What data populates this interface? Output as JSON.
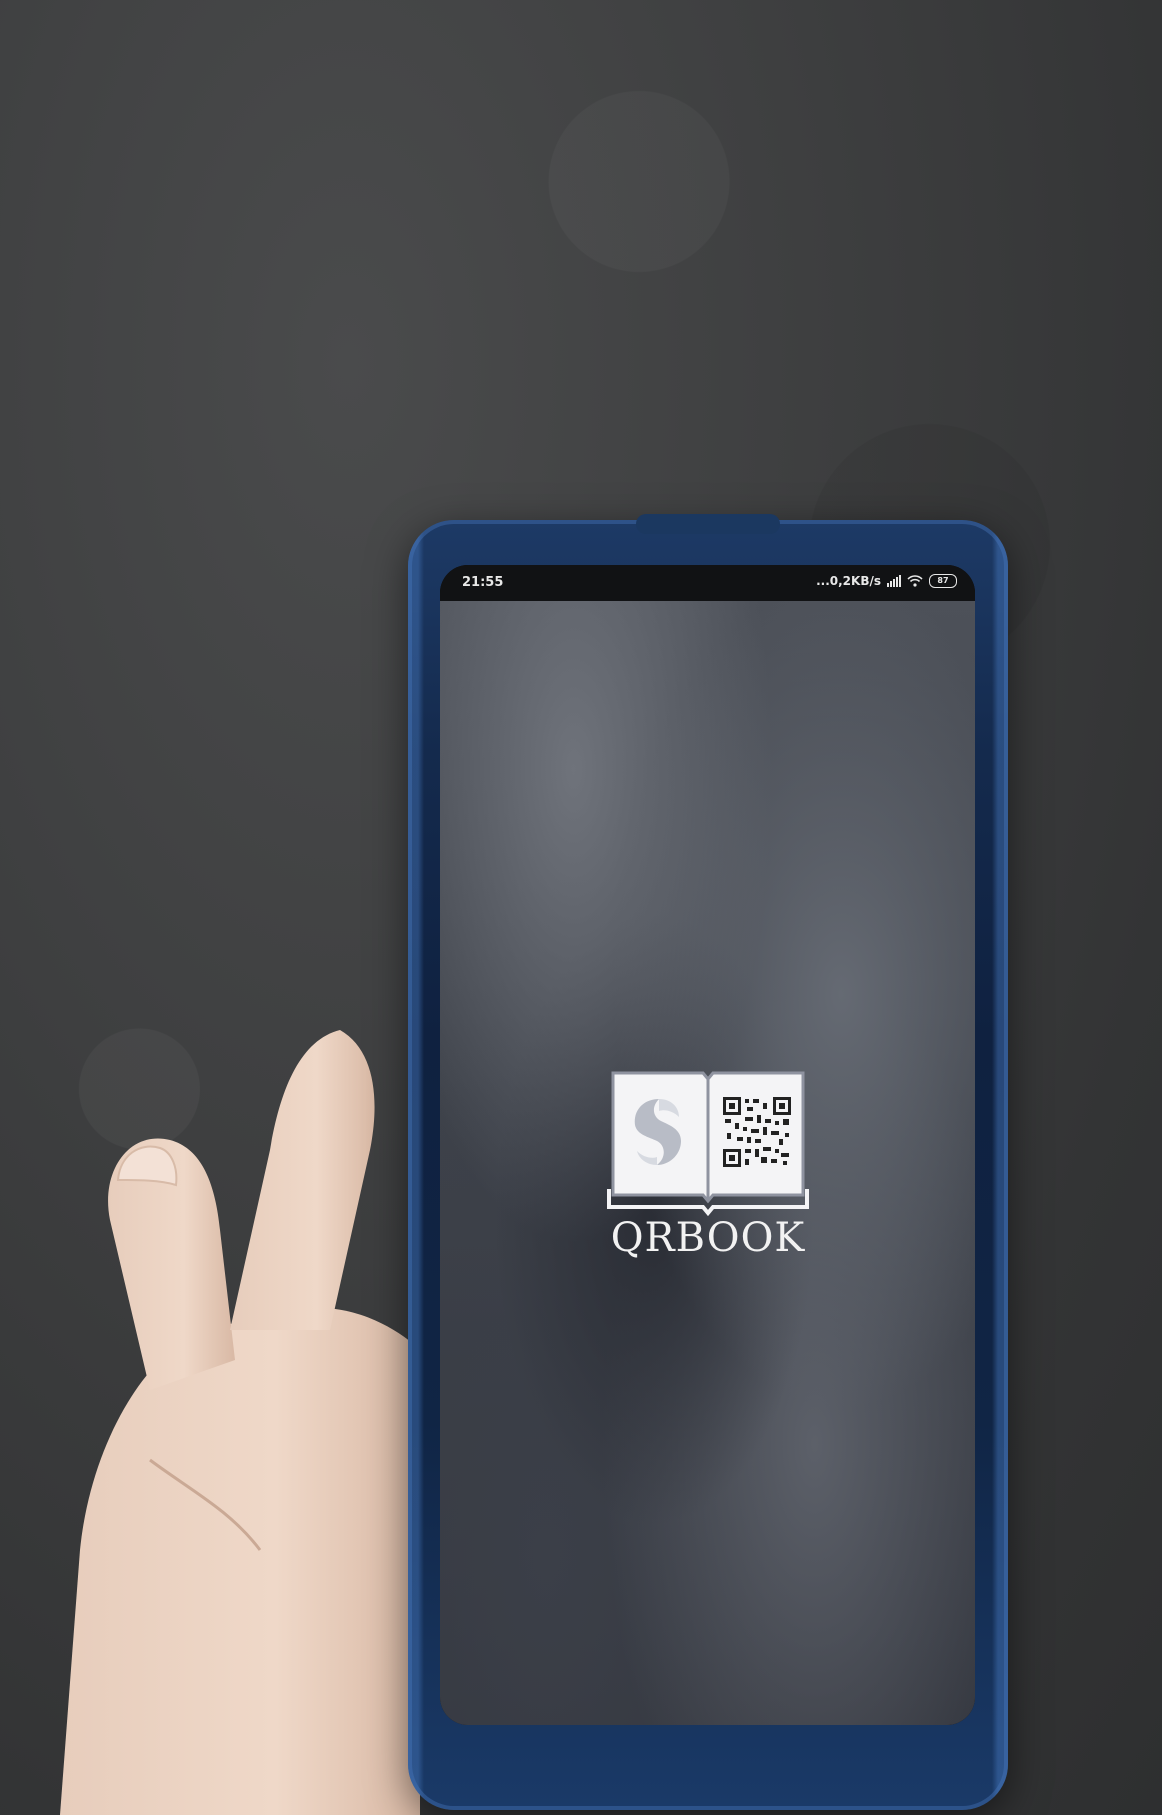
{
  "status_bar": {
    "time": "21:55",
    "network_speed": "...0,2KB/s",
    "battery_level": "87",
    "icons": [
      "signal-icon",
      "wifi-icon",
      "battery-icon"
    ]
  },
  "splash": {
    "app_name": "QRBOOK",
    "logo_icon": "open-book-qr-logo-icon"
  },
  "colors": {
    "case": "#142a4d",
    "background_wall": "#3a3b3c",
    "wordmark": "#f2f2f2"
  }
}
